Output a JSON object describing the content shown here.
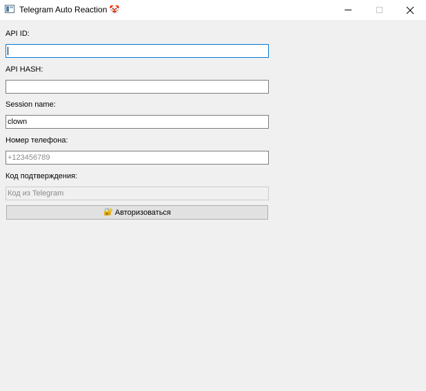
{
  "window": {
    "title": "Telegram Auto Reaction 🤡",
    "icons": {
      "app": "app-window-icon",
      "minimize": "minimize-icon",
      "maximize": "maximize-icon",
      "close": "close-icon"
    }
  },
  "form": {
    "api_id": {
      "label": "API ID:",
      "value": "",
      "placeholder": ""
    },
    "api_hash": {
      "label": "API HASH:",
      "value": "",
      "placeholder": ""
    },
    "session": {
      "label": "Session name:",
      "value": "clown",
      "placeholder": ""
    },
    "phone": {
      "label": "Номер телефона:",
      "value": "",
      "placeholder": "+123456789"
    },
    "code": {
      "label": "Код подтверждения:",
      "value": "",
      "placeholder": "Код из Telegram"
    },
    "auth_button": {
      "icon": "🔐",
      "icon_name": "lock-key-icon",
      "label": "Авторизоваться"
    }
  }
}
